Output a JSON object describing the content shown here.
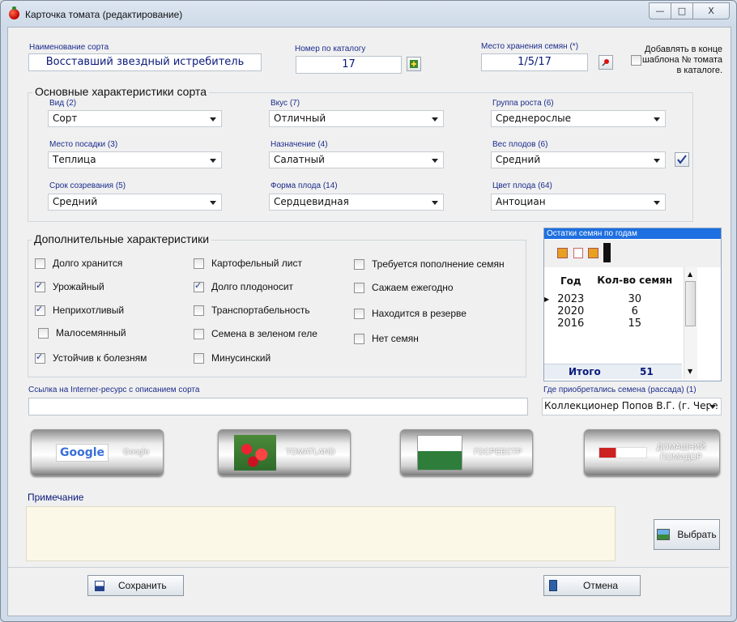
{
  "window": {
    "title": "Карточка томата (редактирование)",
    "minimize": "—",
    "maximize": "□",
    "close": "X"
  },
  "top": {
    "variety_label": "Наименование сорта",
    "variety_value": "Восставший звездный истребитель",
    "catalog_label": "Номер по каталогу",
    "catalog_value": "17",
    "storage_label": "Место хранения семян (*)",
    "storage_value": "1/5/17",
    "append_label": "Добавлять в конце шаблона № томата в каталоге."
  },
  "main": {
    "title": "Основные характеристики сорта",
    "fields": [
      {
        "label": "Вид (2)",
        "value": "Сорт"
      },
      {
        "label": "Вкус (7)",
        "value": "Отличный"
      },
      {
        "label": "Группа роста (6)",
        "value": "Среднерослые"
      },
      {
        "label": "Место посадки (3)",
        "value": "Теплица"
      },
      {
        "label": "Назначение (4)",
        "value": "Салатный"
      },
      {
        "label": "Вес плодов (6)",
        "value": "Средний"
      },
      {
        "label": "Срок созревания (5)",
        "value": "Средний"
      },
      {
        "label": "Форма плода (14)",
        "value": "Сердцевидная"
      },
      {
        "label": "Цвет плода (64)",
        "value": "Антоциан"
      }
    ]
  },
  "extra": {
    "title": "Дополнительные характеристики",
    "items": [
      {
        "label": "Долго хранится",
        "checked": false
      },
      {
        "label": "Урожайный",
        "checked": true
      },
      {
        "label": "Неприхотливый",
        "checked": true
      },
      {
        "label": "Малосемянный",
        "checked": false
      },
      {
        "label": "Устойчив к болезням",
        "checked": true
      },
      {
        "label": "Картофельный лист",
        "checked": false
      },
      {
        "label": "Долго плодоносит",
        "checked": true
      },
      {
        "label": "Транспортабельность",
        "checked": false
      },
      {
        "label": "Семена в зеленом геле",
        "checked": false
      },
      {
        "label": "Минусинский",
        "checked": false
      },
      {
        "label": "Требуется пополнение семян",
        "checked": false
      },
      {
        "label": "Сажаем ежегодно",
        "checked": false
      },
      {
        "label": "Находится в резерве",
        "checked": false
      },
      {
        "label": "Нет семян",
        "checked": false
      }
    ]
  },
  "seeds": {
    "title": "Остатки семян по годам",
    "col_year": "Год",
    "col_count": "Кол-во семян",
    "rows": [
      {
        "year": "2023",
        "count": "30"
      },
      {
        "year": "2020",
        "count": "6"
      },
      {
        "year": "2016",
        "count": "15"
      }
    ],
    "total_label": "Итого",
    "total_value": "51"
  },
  "link": {
    "label": "Ссылка на Interner-ресурс с описанием сорта",
    "value": ""
  },
  "source": {
    "label": "Где приобретались семена (рассада) (1)",
    "value": "Коллекционер Попов В.Г. (г. Чере"
  },
  "buttons": {
    "google_logo": "Google",
    "google": "Google",
    "tomatland": "TOMATLAND",
    "gosreestr": "ГОСРЕЕСТР",
    "domashniy": "ДОМАШНИЙ ПОМИДОР",
    "select": "Выбрать",
    "save": "Сохранить",
    "cancel": "Отмена"
  },
  "note": {
    "label": "Примечание",
    "value": ""
  }
}
